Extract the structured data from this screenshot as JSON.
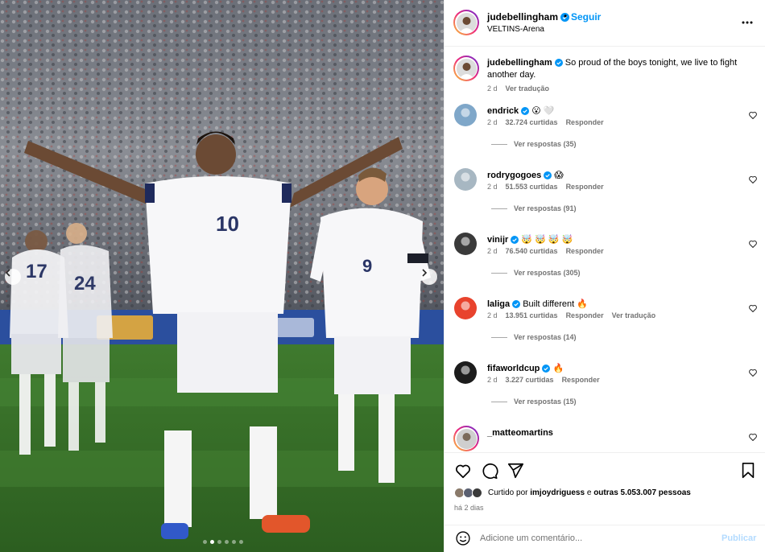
{
  "post": {
    "author": "judebellingham",
    "location": "VELTINS-Arena",
    "follow_label": "Seguir",
    "separator": "•",
    "caption": "So proud of the boys tonight, we live to fight another day.",
    "caption_time": "2 d",
    "translate_label": "Ver tradução",
    "player_numbers": [
      "10",
      "9",
      "17",
      "24"
    ]
  },
  "carousel": {
    "total_slides": 6,
    "active_index": 1
  },
  "comments": [
    {
      "user": "endrick",
      "text": "😮 🤍",
      "time": "2 d",
      "likes": "32.724 curtidas",
      "reply": "Responder",
      "translate": "",
      "replies": "Ver respostas (35)"
    },
    {
      "user": "rodrygogoes",
      "text": "😱",
      "time": "2 d",
      "likes": "51.553 curtidas",
      "reply": "Responder",
      "translate": "",
      "replies": "Ver respostas (91)"
    },
    {
      "user": "vinijr",
      "text": "🤯 🤯 🤯 🤯",
      "time": "2 d",
      "likes": "76.540 curtidas",
      "reply": "Responder",
      "translate": "",
      "replies": "Ver respostas (305)"
    },
    {
      "user": "laliga",
      "text": "Built different 🔥",
      "time": "2 d",
      "likes": "13.951 curtidas",
      "reply": "Responder",
      "translate": "Ver tradução",
      "replies": "Ver respostas (14)"
    },
    {
      "user": "fifaworldcup",
      "text": "🔥",
      "time": "2 d",
      "likes": "3.227 curtidas",
      "reply": "Responder",
      "translate": "",
      "replies": "Ver respostas (15)"
    },
    {
      "user": "_matteomartins",
      "text": "",
      "time": "",
      "likes": "",
      "reply": "",
      "translate": "",
      "replies": ""
    }
  ],
  "likes": {
    "prefix": "Curtido por",
    "user": "imjoydriguess",
    "middle": "e",
    "others": "outras 5.053.007 pessoas"
  },
  "posted_ago": "há 2 dias",
  "add_comment": {
    "placeholder": "Adicione um comentário...",
    "publish_label": "Publicar"
  },
  "colors": {
    "accent": "#0095f6",
    "verified": "#0095f6",
    "meta": "#737373",
    "border": "#efefef",
    "publish_disabled": "#b3dbff"
  }
}
